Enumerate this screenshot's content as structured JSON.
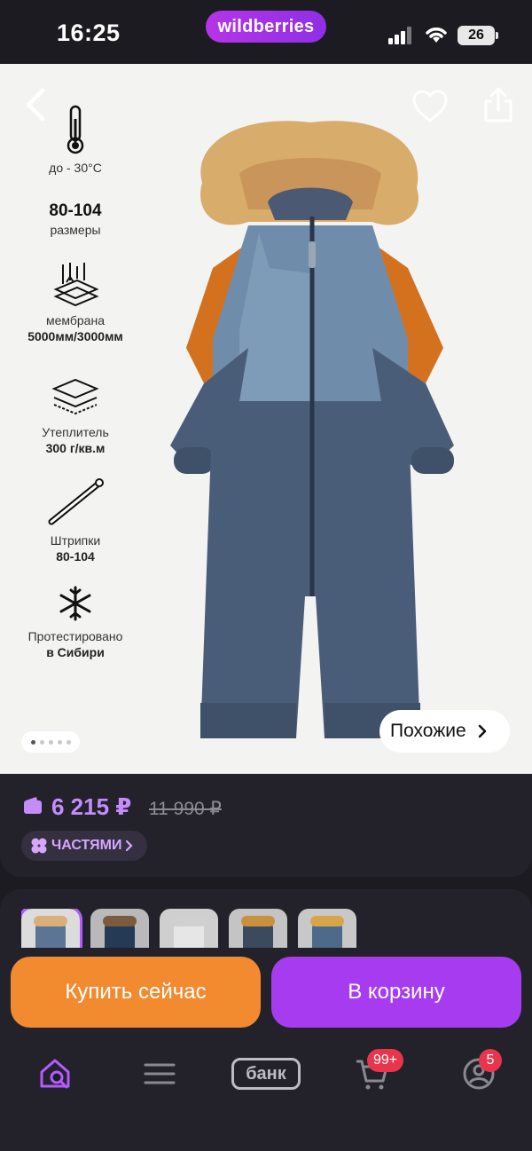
{
  "status_bar": {
    "time": "16:25",
    "app_pill": "wildberries",
    "battery": "26"
  },
  "product_image": {
    "features": [
      {
        "icon": "thermometer-icon",
        "text": "до - 30°C"
      },
      {
        "big": "80-104",
        "text": "размеры"
      },
      {
        "icon": "membrane-icon",
        "line1": "мембрана",
        "line2": "5000мм/3000мм"
      },
      {
        "icon": "layers-icon",
        "line1": "Утеплитель",
        "line2": "300 г/кв.м"
      },
      {
        "icon": "strap-icon",
        "line1": "Штрипки",
        "line2": "80-104"
      },
      {
        "icon": "snowflake-icon",
        "line1": "Протестировано",
        "line2": "в Сибири"
      }
    ],
    "similar_label": "Похожие",
    "carousel_dots": 5
  },
  "price": {
    "current": "6 215 ₽",
    "old": "11 990 ₽",
    "installments": "ЧАСТЯМИ"
  },
  "actions": {
    "buy_now": "Купить сейчас",
    "add_to_cart": "В корзину"
  },
  "tabbar": {
    "bank": "банк",
    "cart_badge": "99+",
    "profile_badge": "5"
  },
  "colors": {
    "accent": "#a73bf0",
    "buy": "#f28a2f",
    "price": "#c58cff",
    "badge": "#e8354d"
  }
}
